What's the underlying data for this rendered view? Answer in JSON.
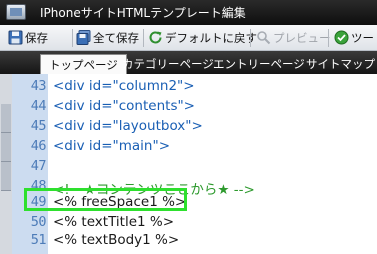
{
  "window": {
    "title": "IPhoneサイトHTMLテンプレート編集"
  },
  "toolbar": {
    "save_label": "保存",
    "save_all_label": "全て保存",
    "restore_default_label": "デフォルトに戻す",
    "preview_label": "プレビュー",
    "tools_label": "ツー"
  },
  "tabs": [
    {
      "label": "トップページ"
    },
    {
      "label": "カテゴリーページ"
    },
    {
      "label": "エントリーページ"
    },
    {
      "label": "サイトマップ"
    }
  ],
  "editor": {
    "lines": [
      {
        "number": "43",
        "text": "<div id=\"column2\">"
      },
      {
        "number": "44",
        "text": "<div id=\"contents\">"
      },
      {
        "number": "45",
        "text": "<div id=\"layoutbox\">"
      },
      {
        "number": "46",
        "text": "<div id=\"main\">"
      },
      {
        "number": "47",
        "text": ""
      },
      {
        "number": "48",
        "text": "<!-- ★コンテンツここから★ -->"
      },
      {
        "number": "49",
        "text": "<% freeSpace1 %>"
      },
      {
        "number": "50",
        "text": "<% textTitle1 %>"
      },
      {
        "number": "51",
        "text": "<% textBody1 %>"
      }
    ]
  },
  "colors": {
    "highlight": "#2ee02e",
    "comment": "#2e9a2e",
    "code": "#1a5fb4",
    "gutter": "#ccdcf0"
  }
}
